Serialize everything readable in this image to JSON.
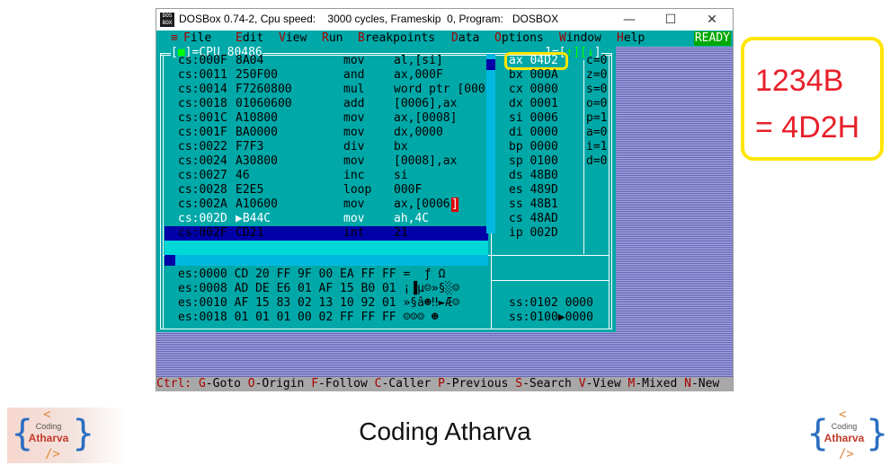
{
  "window": {
    "title": "DOSBox 0.74-2, Cpu speed:    3000 cycles, Frameskip  0, Program:   DOSBOX",
    "min": "—",
    "max": "☐",
    "close": "✕"
  },
  "menu": {
    "sys": "≡",
    "items": [
      {
        "hot": "F",
        "rest": "ile"
      },
      {
        "hot": "E",
        "rest": "dit"
      },
      {
        "hot": "V",
        "rest": "iew"
      },
      {
        "hot": "R",
        "rest": "un"
      },
      {
        "hot": "B",
        "rest": "reakpoints"
      },
      {
        "hot": "D",
        "rest": "ata"
      },
      {
        "hot": "O",
        "rest": "ptions"
      },
      {
        "hot": "W",
        "rest": "indow"
      },
      {
        "hot": "H",
        "rest": "elp"
      }
    ],
    "status": "READY"
  },
  "cpu": {
    "title_prefix": "[",
    "title_mark": "■",
    "title_rest": "]=CPU 80486",
    "right_title": "1=[",
    "right_title_arrows": "↑][↓",
    "right_title_end": "]",
    "code": [
      {
        "addr": "cs:000F",
        "bytes": "8A04",
        "op": "mov",
        "args": "al,[si]"
      },
      {
        "addr": "cs:0011",
        "bytes": "250F00",
        "op": "and",
        "args": "ax,000F"
      },
      {
        "addr": "cs:0014",
        "bytes": "F7260800",
        "op": "mul",
        "args": "word ptr [000"
      },
      {
        "addr": "cs:0018",
        "bytes": "01060600",
        "op": "add",
        "args": "[0006],ax"
      },
      {
        "addr": "cs:001C",
        "bytes": "A10800",
        "op": "mov",
        "args": "ax,[0008]"
      },
      {
        "addr": "cs:001F",
        "bytes": "BA0000",
        "op": "mov",
        "args": "dx,0000"
      },
      {
        "addr": "cs:0022",
        "bytes": "F7F3",
        "op": "div",
        "args": "bx"
      },
      {
        "addr": "cs:0024",
        "bytes": "A30800",
        "op": "mov",
        "args": "[0008],ax"
      },
      {
        "addr": "cs:0027",
        "bytes": "46",
        "op": "inc",
        "args": "si"
      },
      {
        "addr": "cs:0028",
        "bytes": "E2E5",
        "op": "loop",
        "args": "000F"
      },
      {
        "addr": "cs:002A",
        "bytes": "A10600",
        "op": "mov",
        "args": "ax,[0006"
      },
      {
        "addr": "cs:002D",
        "bytes": "▶B44C",
        "op": "mov",
        "args": "ah,4C"
      },
      {
        "addr": "cs:002F",
        "bytes": "CD21",
        "op": "int",
        "args": "21"
      }
    ],
    "code_cursor_char": "]",
    "registers": [
      "ax 04D2",
      "bx 000A",
      "cx 0000",
      "dx 0001",
      "si 0006",
      "di 0000",
      "bp 0000",
      "sp 0100",
      "ds 48B0",
      "es 489D",
      "ss 48B1",
      "cs 48AD",
      "ip 002D"
    ],
    "flags": [
      "c=0",
      "z=0",
      "s=0",
      "o=0",
      "p=1",
      "a=0",
      "i=1",
      "d=0"
    ],
    "dump": [
      "es:0000 CD 20 FF 9F 00 EA FF FF =  ƒ Ω",
      "es:0008 AD DE E6 01 AF 15 B0 01 ¡▐µ☺»§░☺",
      "es:0010 AF 15 83 02 13 10 92 01 »§â☻‼►Æ☺",
      "es:0018 01 01 01 00 02 FF FF FF ☺☺☺ ☻"
    ],
    "stack": [
      "ss:0102 0000",
      "ss:0100▶0000"
    ]
  },
  "statusbar": [
    {
      "k": "Ctrl:",
      "t": " "
    },
    {
      "k": "G",
      "t": "-Goto "
    },
    {
      "k": "O",
      "t": "-Origin "
    },
    {
      "k": "F",
      "t": "-Follow "
    },
    {
      "k": "C",
      "t": "-Caller "
    },
    {
      "k": "P",
      "t": "-Previous "
    },
    {
      "k": "S",
      "t": "-Search "
    },
    {
      "k": "V",
      "t": "-View "
    },
    {
      "k": "M",
      "t": "-Mixed "
    },
    {
      "k": "N",
      "t": "-New"
    }
  ],
  "note": {
    "line1": "1234B",
    "line2": "= 4D2H"
  },
  "footer": {
    "title": "Coding Atharva"
  },
  "logo": {
    "open": "{",
    "close": "}",
    "lt": "<",
    "gt": "/>",
    "line1": "Coding",
    "line2": "Atharva"
  },
  "colors": {
    "highlight": "#ffe600",
    "note_text": "#e8202a",
    "cyan": "#00a8a8",
    "blue": "#0000a8"
  }
}
